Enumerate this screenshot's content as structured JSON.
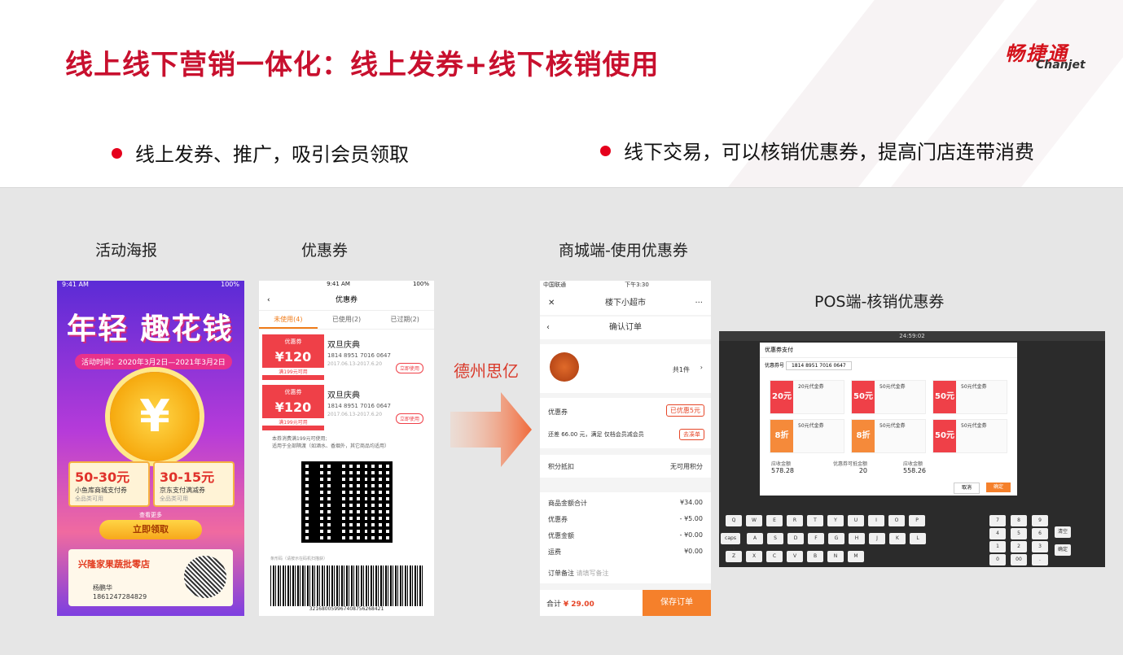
{
  "header": {
    "title": "线上线下营销一体化：线上发券+线下核销使用",
    "logo_cn": "畅捷通",
    "logo_en": "Chanjet",
    "bullet_left": "线上发券、推广，吸引会员领取",
    "bullet_right": "线下交易，可以核销优惠券，提高门店连带消费"
  },
  "captions": {
    "poster": "活动海报",
    "coupon": "优惠券",
    "mall": "商城端-使用优惠券",
    "pos": "POS端-核销优惠券",
    "arrow": "德州思亿"
  },
  "poster": {
    "time": "9:41 AM",
    "battery": "100%",
    "headline": "年轻 趣花钱",
    "period": "活动时间：2020年3月2日—2021年3月2日",
    "ticket1_amount": "50-30元",
    "ticket1_desc": "小鱼库商城支付券",
    "ticket1_sub": "全品类可用",
    "ticket2_amount": "30-15元",
    "ticket2_desc": "京东支付满减券",
    "ticket2_sub": "全品类可用",
    "more": "查看更多",
    "button": "立即领取",
    "shop": "兴隆家果蔬批零店",
    "person": "杨鹏华",
    "phone": "18612472848​29"
  },
  "coupon": {
    "time": "9:41 AM",
    "battery": "100%",
    "title": "优惠券",
    "tabs": [
      "未使用(4)",
      "已使用(2)",
      "已过期(2)"
    ],
    "card_tag": "优惠券",
    "card_amount": "¥120",
    "card_cond": "满199元可用",
    "card_name": "双旦庆典",
    "card_no": "1814 8951 7016 0647",
    "card_date": "2017.06.13-2017.6.20",
    "card_btn": "立即使用",
    "desc1": "本券消费满199元可使用;",
    "desc2": "适用于全部隔渡（如酒水、香烟外，其它商品均适用）",
    "note": "条形码（请按示在码机扫描获）",
    "barcode_no": "3216800599674087562684​21"
  },
  "shop": {
    "carrier": "中国联通",
    "time": "下午3:30",
    "store": "楼下小超市",
    "page": "确认订单",
    "qty": "共1件",
    "coupon_label": "优惠券",
    "coupon_value": "已优惠5元",
    "member_text": "还差 66.00 元，满足 仅档会员减会员",
    "member_btn": "去凑单",
    "points_label": "积分抵扣",
    "points_value": "无可用积分",
    "rows": [
      {
        "label": "商品金额合计",
        "value": "¥34.00"
      },
      {
        "label": "优惠券",
        "value": "- ¥5.00"
      },
      {
        "label": "优惠金额",
        "value": "- ¥0.00"
      },
      {
        "label": "运费",
        "value": "¥0.00"
      }
    ],
    "remark_label": "订单备注",
    "remark_placeholder": "请填写备注",
    "total_label": "合计",
    "total_value": "¥ 29.00",
    "pay": "保存订单"
  },
  "pos": {
    "dialog_title": "优惠券支付",
    "coupon_no_label": "优惠券号",
    "coupon_no": "1814 8951 7016 0647",
    "cards": [
      {
        "tag": "20元",
        "name": "20元代金券"
      },
      {
        "tag": "50元",
        "name": "50元代金券"
      },
      {
        "tag": "50元",
        "name": "50元代金券"
      },
      {
        "tag": "8折",
        "name": "50元代金券"
      },
      {
        "tag": "8折",
        "name": "50元代金券"
      },
      {
        "tag": "50元",
        "name": "50元代金券"
      }
    ],
    "sum1_label": "应收金额",
    "sum1": "578.28",
    "sum2_label": "优惠券可抵金额",
    "sum2": "20",
    "sum3_label": "应收金额",
    "sum3": "558.26",
    "cancel": "取消",
    "ok": "确定",
    "clock": "24:59:02",
    "keys_row1": [
      "Q",
      "W",
      "E",
      "R",
      "T",
      "Y",
      "U",
      "I",
      "O",
      "P"
    ],
    "keys_row2": [
      "A",
      "S",
      "D",
      "F",
      "G",
      "H",
      "J",
      "K",
      "L"
    ],
    "keys_row3": [
      "Z",
      "X",
      "C",
      "V",
      "B",
      "N",
      "M"
    ],
    "numpad": [
      "7",
      "8",
      "9",
      "4",
      "5",
      "6",
      "1",
      "2",
      "3",
      "0",
      "00",
      "."
    ],
    "clear": "清空",
    "confirm": "确定",
    "caps": "caps lock"
  },
  "colors": {
    "brand_red": "#c8102e",
    "accent_orange": "#f5802b"
  }
}
